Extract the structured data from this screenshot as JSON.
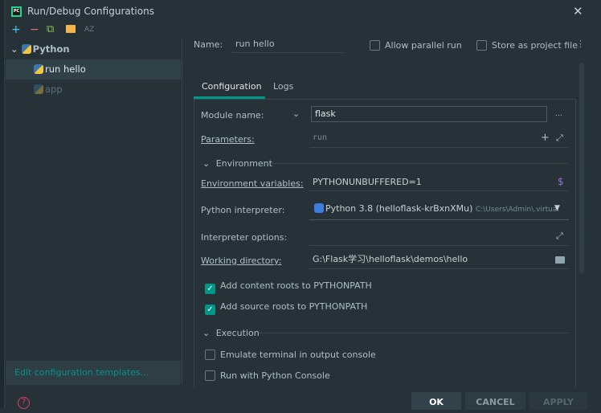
{
  "window": {
    "title": "Run/Debug Configurations"
  },
  "toolbar": {
    "add": "+",
    "remove": "−",
    "copy": "⧉",
    "folder": "▰",
    "sort": "AZ"
  },
  "tree": {
    "group": "Python",
    "items": [
      {
        "label": "run hello",
        "selected": true
      },
      {
        "label": "app",
        "selected": false
      }
    ]
  },
  "left_footer": {
    "edit_templates": "Edit configuration templates..."
  },
  "name": {
    "label": "Name:",
    "value": "run hello"
  },
  "options": {
    "allow_parallel": {
      "label": "Allow parallel run",
      "checked": false
    },
    "store_project": {
      "label": "Store as project file",
      "checked": false
    }
  },
  "tabs": [
    {
      "label": "Configuration",
      "active": true
    },
    {
      "label": "Logs",
      "active": false
    }
  ],
  "form": {
    "module": {
      "label": "Module name:",
      "value": "flask"
    },
    "parameters": {
      "label": "Parameters:",
      "value": "run"
    },
    "environment_section": "Environment",
    "env_vars": {
      "label": "Environment variables:",
      "value": "PYTHONUNBUFFERED=1"
    },
    "interpreter": {
      "label": "Python interpreter:",
      "value": "Python 3.8 (helloflask-krBxnXMu)",
      "path": "C:\\Users\\Admin\\.virtual"
    },
    "interp_options": {
      "label": "Interpreter options:",
      "value": ""
    },
    "working_dir": {
      "label": "Working directory:",
      "value": "G:\\Flask学习\\helloflask\\demos\\hello"
    },
    "content_roots": {
      "label": "Add content roots to PYTHONPATH",
      "checked": true
    },
    "source_roots": {
      "label": "Add source roots to PYTHONPATH",
      "checked": true
    },
    "execution_section": "Execution",
    "emulate_terminal": {
      "label": "Emulate terminal in output console",
      "checked": false
    },
    "python_console": {
      "label": "Run with Python Console",
      "checked": false
    }
  },
  "buttons": {
    "ok": "OK",
    "cancel": "CANCEL",
    "apply": "APPLY"
  },
  "colors": {
    "background": "#263238",
    "accent": "#009688",
    "selection": "#314148"
  }
}
